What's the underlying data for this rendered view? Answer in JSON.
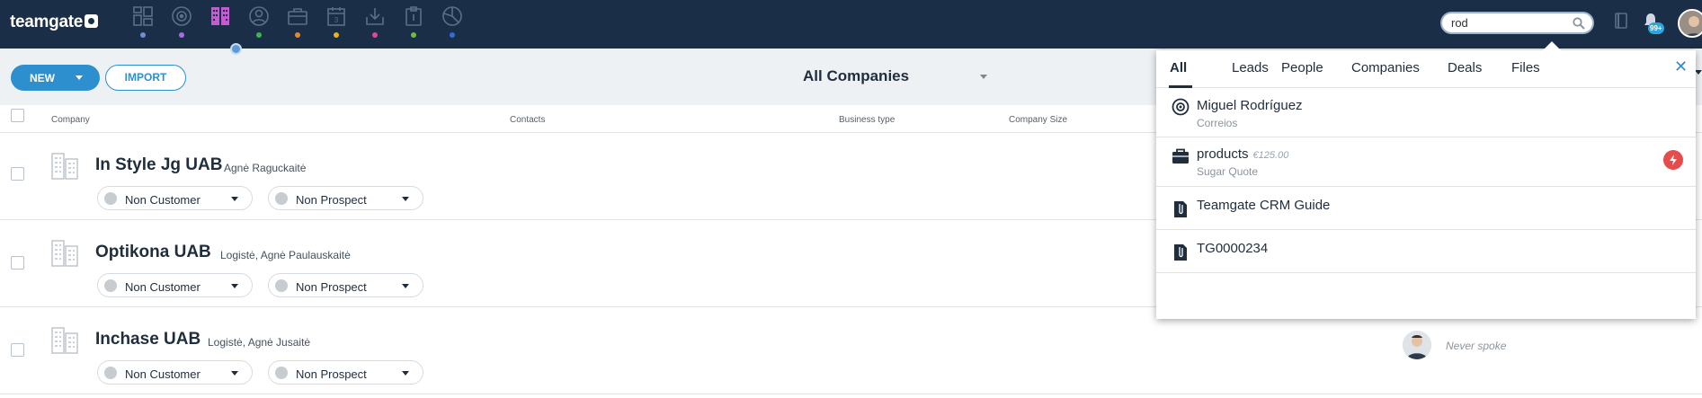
{
  "app": {
    "logo_text": "teamgate"
  },
  "nav": {
    "items": [
      {
        "icon": "dashboard-icon",
        "color": "#6f8ddb"
      },
      {
        "icon": "target-icon",
        "color": "#a66ee0"
      },
      {
        "icon": "companies-icon",
        "color": "#c45bd0"
      },
      {
        "icon": "people-icon",
        "color": "#3fb54a"
      },
      {
        "icon": "briefcase-icon",
        "color": "#e08a2d"
      },
      {
        "icon": "calendar-icon",
        "color": "#e6b51a"
      },
      {
        "icon": "download-icon",
        "color": "#e0479a"
      },
      {
        "icon": "clipboard-icon",
        "color": "#6fbd3c"
      },
      {
        "icon": "chart-icon",
        "color": "#2f6fcf"
      }
    ],
    "active_index": 2
  },
  "search": {
    "value": "rod"
  },
  "notifications": {
    "badge": "99+"
  },
  "toolbar": {
    "new_label": "NEW",
    "import_label": "IMPORT",
    "view_label": "All Companies"
  },
  "columns": {
    "company": "Company",
    "contacts": "Contacts",
    "business_type": "Business type",
    "company_size": "Company Size"
  },
  "rows": [
    {
      "name": "In Style Jg UAB",
      "contacts": "Agnė Raguckaitė",
      "status": "Non Customer",
      "prospect": "Non Prospect"
    },
    {
      "name": "Optikona UAB",
      "contacts": "Logistė, Agnė Paulauskaitė",
      "status": "Non Customer",
      "prospect": "Non Prospect"
    },
    {
      "name": "Inchase UAB",
      "contacts": "Logistė, Agnė Jusaitė",
      "status": "Non Customer",
      "prospect": "Non Prospect",
      "last_contact": "Never spoke"
    }
  ],
  "search_popup": {
    "tabs": [
      "All",
      "Leads",
      "People",
      "Companies",
      "Deals",
      "Files"
    ],
    "active_tab": "All",
    "close": "✕",
    "results": [
      {
        "icon": "lead-target-icon",
        "title": "Miguel Rodríguez",
        "subtitle": "Correios"
      },
      {
        "icon": "deal-briefcase-icon",
        "title": "products",
        "value": "€125.00",
        "subtitle": "Sugar Quote",
        "badge_color": "#e54d4d"
      },
      {
        "icon": "file-clip-icon",
        "title": "Teamgate CRM Guide"
      },
      {
        "icon": "file-clip-icon",
        "title": "TG0000234"
      }
    ]
  }
}
